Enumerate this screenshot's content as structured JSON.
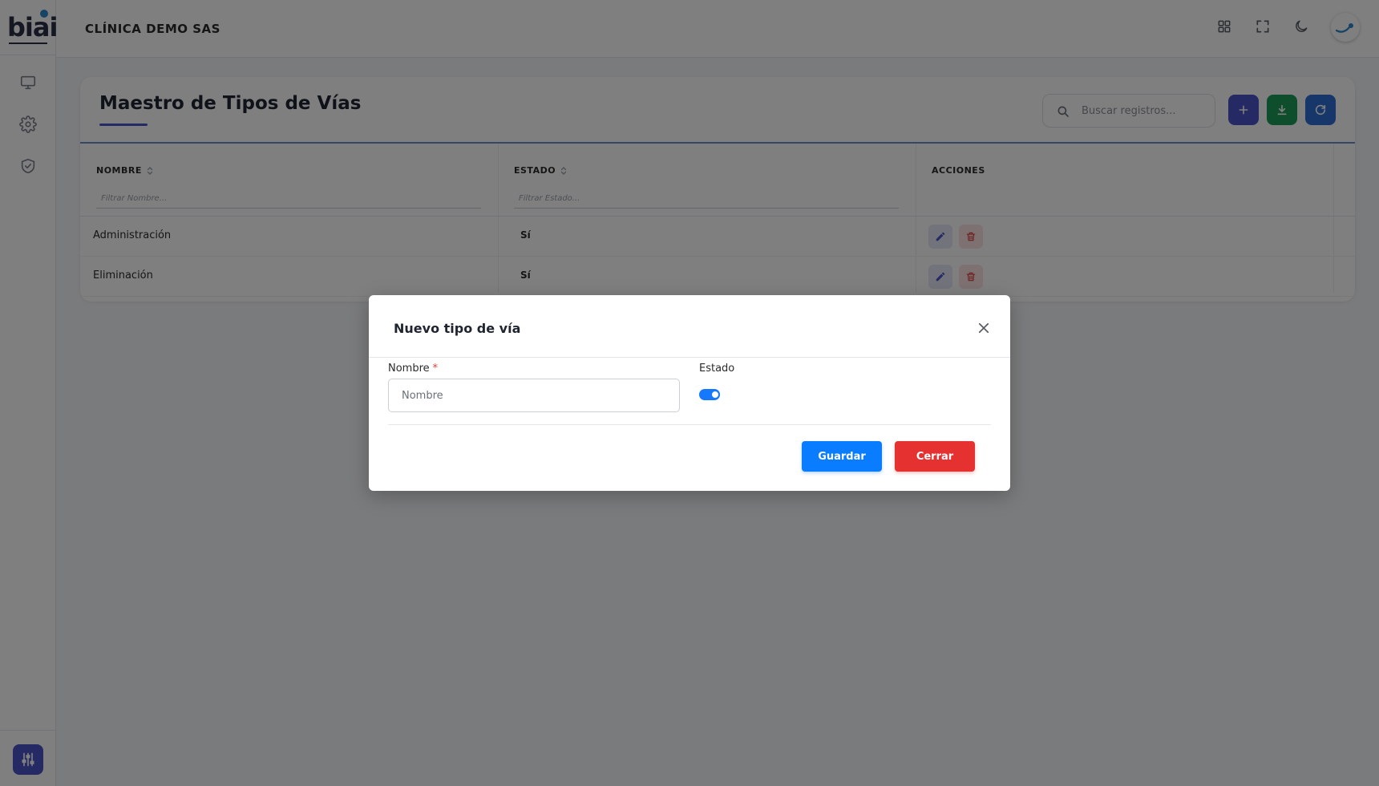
{
  "app": {
    "logo_text": "biai",
    "company": "CLÍNICA DEMO SAS"
  },
  "sidebar": {
    "items": [
      {
        "icon": "monitor-icon"
      },
      {
        "icon": "gear-icon"
      },
      {
        "icon": "shield-check-icon"
      }
    ],
    "bottom_icon": "sliders-icon"
  },
  "topbar": {
    "icons": [
      "grid-icon",
      "fullscreen-icon",
      "moon-icon"
    ],
    "avatar_icon": "brand-avatar-icon"
  },
  "page": {
    "title": "Maestro de Tipos de Vías",
    "search_placeholder": "Buscar registros...",
    "toolbar": {
      "add_color": "#4a55c9",
      "download_color": "#1e9c5a",
      "refresh_color": "#2f6fd6"
    }
  },
  "table": {
    "columns": [
      {
        "label": "NOMBRE",
        "filter_placeholder": "Filtrar Nombre..."
      },
      {
        "label": "ESTADO",
        "filter_placeholder": "Filtrar Estado..."
      },
      {
        "label": "ACCIONES"
      }
    ],
    "rows": [
      {
        "name": "Administración",
        "state": "Sí"
      },
      {
        "name": "Eliminación",
        "state": "Sí"
      }
    ]
  },
  "modal": {
    "title": "Nuevo tipo de vía",
    "name_label": "Nombre",
    "required_mark": "*",
    "name_placeholder": "Nombre",
    "name_value": "",
    "state_label": "Estado",
    "state_enabled": true,
    "save_label": "Guardar",
    "close_label": "Cerrar"
  },
  "colors": {
    "accent": "#4a55c9",
    "primary_button": "#0a7cff",
    "danger_button": "#e63131",
    "toggle": "#1677ff"
  }
}
